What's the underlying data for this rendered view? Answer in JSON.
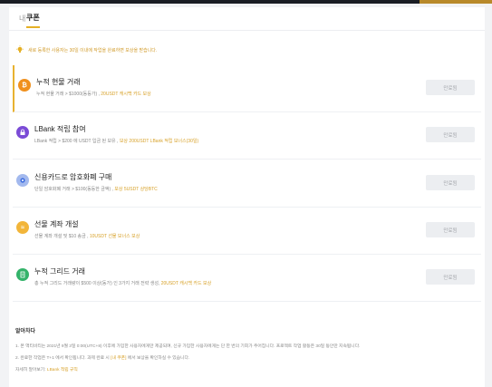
{
  "colors": {
    "accent": "#e5b025",
    "highlight": "#d7a128",
    "button_bg": "#eceef1"
  },
  "tabs": {
    "prefix": "내",
    "active": "쿠폰"
  },
  "notice": {
    "icon": "lightbulb-icon",
    "text": "새로 등록한 사용자는 30일 이내에 작업을 완료하면 보상을 받습니다."
  },
  "tasks": [
    {
      "icon": "bitcoin-icon",
      "icon_color": "#f0901d",
      "icon_glyph": "₿",
      "title": "누적 현물 거래",
      "desc_plain": "누적 현물 거래 > $1000(동등가) ,",
      "desc_highlight": "20USDT 캐시백 카드 보상",
      "button": "만료됨"
    },
    {
      "icon": "lock-icon",
      "icon_color": "#7b4bd6",
      "icon_glyph": "⌂",
      "title": "LBank 적립 참여",
      "desc_plain": "LBank 적립 > $200 에 USDT 입금 된 보유 ,",
      "desc_highlight": "보상 200USDT LBank 적립 보너스(30일)",
      "button": "만료됨"
    },
    {
      "icon": "credit-card-icon",
      "icon_color": "#5a88f0",
      "icon_glyph": "●",
      "title": "신용카드로 암호화폐 구매",
      "desc_plain": "단일 암호화폐 거래 > $100(동등한 금액) ,",
      "desc_highlight": "보상 5USDT 상당BTC",
      "button": "만료됨"
    },
    {
      "icon": "futures-icon",
      "icon_color": "#f2b53a",
      "icon_glyph": "≈",
      "title": "선물 계좌 개설",
      "desc_plain": "선물 계좌 개설 및 $10 송금 ,",
      "desc_highlight": "10USDT 선물 보너스 보상",
      "button": "만료됨"
    },
    {
      "icon": "grid-icon",
      "icon_color": "#34b36a",
      "icon_glyph": "▤",
      "title": "누적 그리드 거래",
      "desc_plain": "총 누적 그리드 거래량이 $500 이상(동가) 인 3가지 거래 전략 생성,",
      "desc_highlight": "20USDT 캐시백 카드 보상",
      "button": "만료됨"
    }
  ],
  "footer": {
    "heading": "알아차다",
    "line1": "1. 본 액티비티는 2021년 9월 3일 0:00(UTC+8) 이후에 가입한 사용자에게만 제공되며, 신규 가입한 사용자에게는 단 한 번의 기회가 주어집니다. 프로젝트 작업 활동은 30일 동안만 지속됩니다.",
    "line2_pre": "2. 완료한 작업은 T+1 에서 확인됩니다. 과제 완료 시",
    "line2_link": "[내 쿠폰]",
    "line2_post": "에서 보상을 확인하실 수 있습니다.",
    "line3_pre": "자세히 알아보기:",
    "line3_link": "LBank 적립 규칙"
  }
}
